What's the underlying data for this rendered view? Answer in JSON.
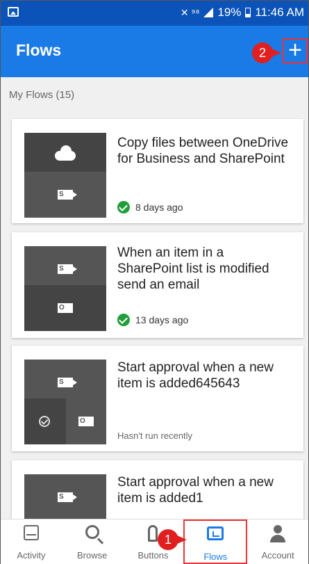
{
  "status_bar": {
    "left_icon": "picture-icon",
    "right_glyphs": "✕ ⁹⁸",
    "battery": "19%",
    "time": "11:46 AM"
  },
  "app_bar": {
    "title": "Flows",
    "add_label": "+"
  },
  "annotations": {
    "marker_1": "1",
    "marker_2": "2"
  },
  "section_label": "My Flows (15)",
  "flows": [
    {
      "title": "Copy files between OneDrive for Business and SharePoint",
      "status": "8 days ago",
      "status_type": "success",
      "icons": [
        "onedrive-icon",
        "sharepoint-icon"
      ]
    },
    {
      "title": "When an item in a SharePoint list is modified send an email",
      "status": "13 days ago",
      "status_type": "success",
      "icons": [
        "sharepoint-icon",
        "outlook-icon"
      ]
    },
    {
      "title": "Start approval when a new item is added645643",
      "status": "Hasn't run recently",
      "status_type": "none",
      "icons": [
        "sharepoint-icon",
        "approvals-icon",
        "outlook-icon"
      ]
    },
    {
      "title": "Start approval when a new item is added1",
      "status": "",
      "status_type": "none",
      "icons": [
        "sharepoint-icon"
      ]
    }
  ],
  "nav": {
    "activity": "Activity",
    "browse": "Browse",
    "buttons": "Buttons",
    "flows": "Flows",
    "account": "Account"
  },
  "colors": {
    "status_bar": "#0b53b8",
    "app_bar": "#1a7ae6",
    "accent": "#1a7ae6",
    "success": "#1f9e3a",
    "annotation": "#e02020"
  }
}
